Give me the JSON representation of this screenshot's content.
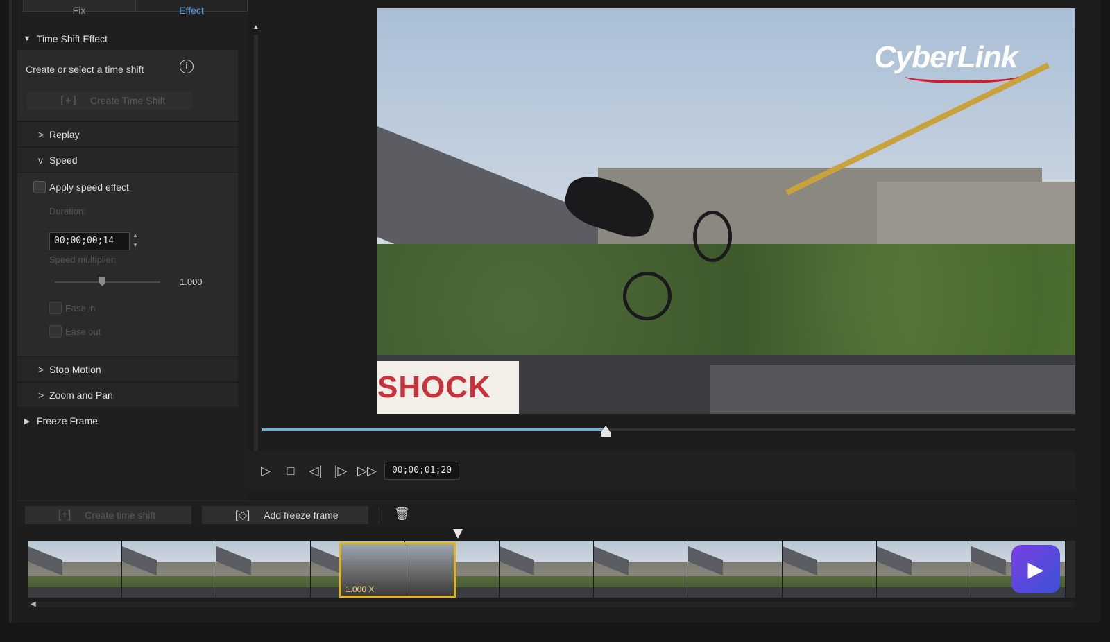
{
  "tabs": [
    {
      "label": "Fix"
    },
    {
      "label": "Effect"
    }
  ],
  "panel": {
    "time_shift": {
      "title": "Time Shift Effect",
      "hint": "Create or select a time shift",
      "create_button": "Create Time Shift",
      "create_icon": "[+]"
    },
    "replay": {
      "label": "Replay"
    },
    "speed": {
      "label": "Speed",
      "apply_label": "Apply speed effect",
      "apply_checked": false,
      "duration_label": "Duration:",
      "duration_value": "00;00;00;14",
      "multiplier_label": "Speed multiplier:",
      "multiplier_value": "1.000",
      "multiplier_level": 0.45,
      "ease_in_label": "Ease in",
      "ease_out_label": "Ease out"
    },
    "stop_motion": {
      "label": "Stop Motion"
    },
    "zoom_pan": {
      "label": "Zoom and Pan"
    },
    "freeze": {
      "label": "Freeze Frame"
    }
  },
  "preview": {
    "brand": "CyberLink",
    "banner_text": "SHOCK"
  },
  "playback": {
    "progress": 0.423,
    "timecode": "00;00;01;20",
    "icons": [
      "play-icon",
      "stop-icon",
      "prev-frame-icon",
      "next-frame-icon",
      "fast-forward-icon"
    ]
  },
  "bottom_toolbar": {
    "create_time_shift": "Create time shift",
    "create_icon": "[+]",
    "add_freeze_frame": "Add freeze frame",
    "freeze_icon": "freeze-frame-icon",
    "delete_icon": "trash-icon"
  },
  "filmstrip": {
    "selected_speed": "1.000 X",
    "frame_count": 11
  },
  "colors": {
    "accent": "#6ab0e0",
    "selection": "#e8b21a",
    "brand_red": "#d01c2e"
  }
}
